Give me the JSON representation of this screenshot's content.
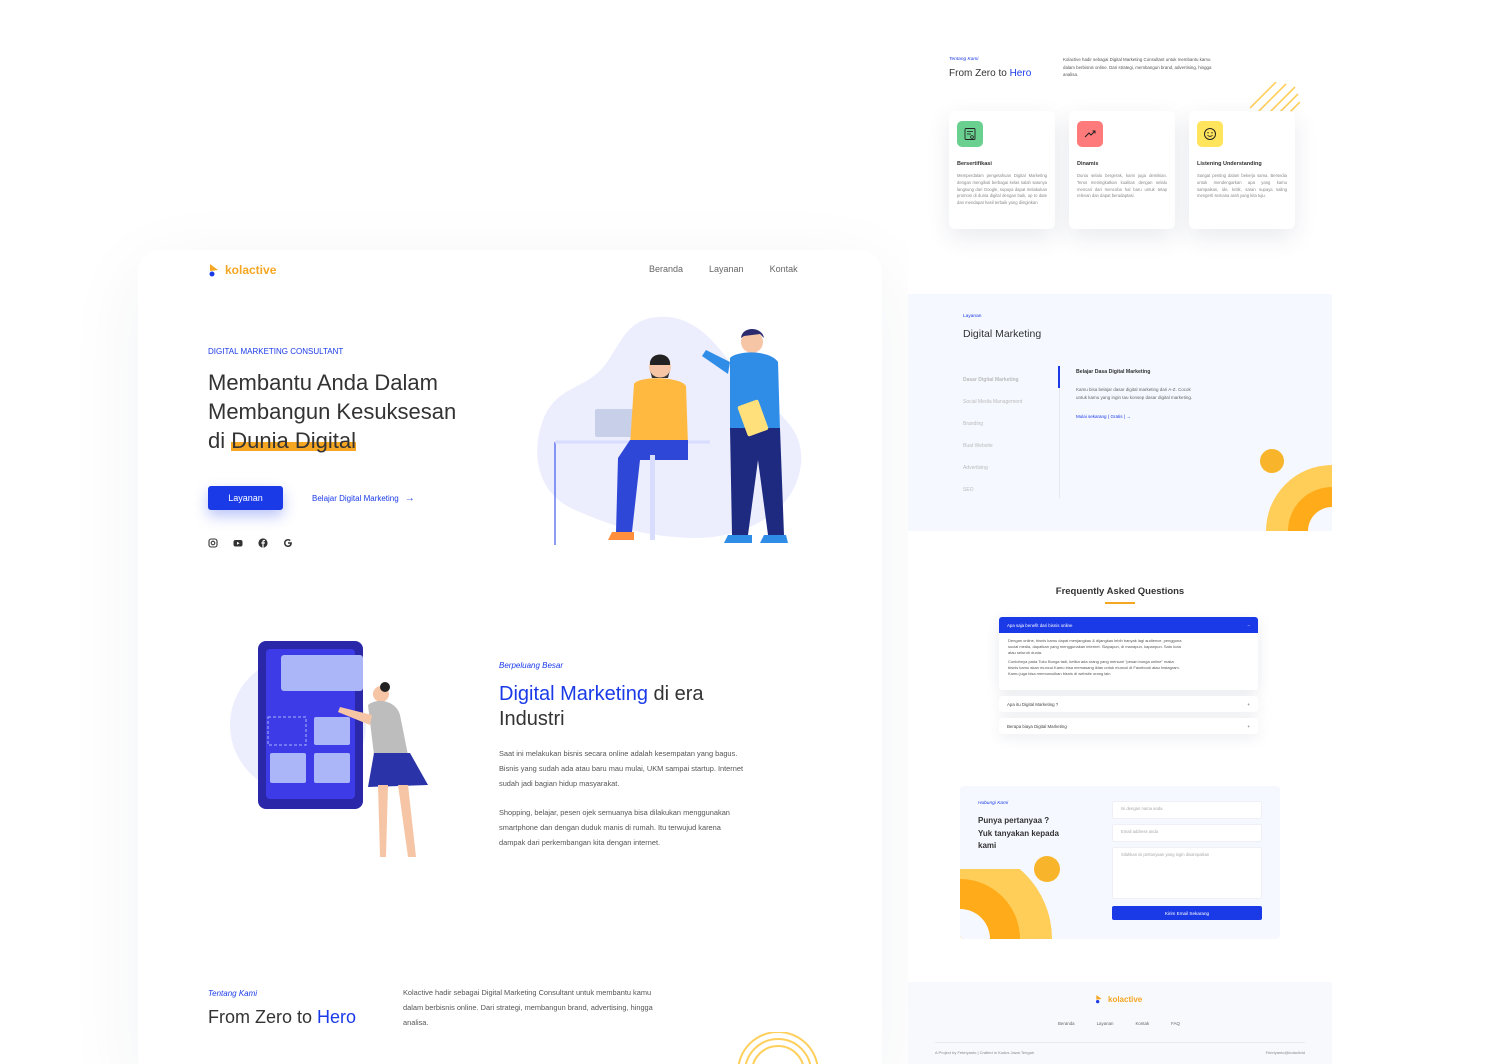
{
  "brand": {
    "name": "kolactive"
  },
  "colors": {
    "primary": "#1a3ae8",
    "accent": "#f5a623",
    "bg_light": "#f5f8ff"
  },
  "nav": [
    {
      "label": "Beranda"
    },
    {
      "label": "Layanan"
    },
    {
      "label": "Kontak"
    }
  ],
  "hero": {
    "eyebrow": "DIGITAL MARKETING CONSULTANT",
    "line1": "Membantu Anda Dalam",
    "line2": "Membangun Kesuksesan",
    "line3_prefix": "di ",
    "line3_highlight": "Dunia Digital",
    "cta_primary": "Layanan",
    "cta_secondary": "Belajar Digital Marketing",
    "socials": [
      "instagram-icon",
      "youtube-icon",
      "facebook-icon",
      "google-icon"
    ]
  },
  "opportunity": {
    "eyebrow": "Berpeluang Besar",
    "title_highlight": "Digital Marketing",
    "title_rest1": " di era",
    "title_rest2": "Industri",
    "para1": [
      "Saat ini melakukan bisnis secara online adalah kesempatan yang bagus.",
      "Bisnis yang sudah ada atau baru mau mulai, UKM sampai startup.  Internet",
      "sudah jadi bagian hidup masyarakat."
    ],
    "para2": [
      "Shopping, belajar, pesen ojek semuanya bisa dilakukan menggunakan",
      "smartphone dan dengan duduk manis di rumah. Itu terwujud karena",
      "dampak dari perkembangan kita dengan internet."
    ]
  },
  "about": {
    "eyebrow": "Tentang Kami",
    "title_prefix": "From Zero to ",
    "title_highlight": "Hero",
    "text": [
      "Kolactive hadir sebagai Digital Marketing Consultant untuk membantu kamu",
      "dalam berbisnis online. Dari strategi, membangun brand, advertising, hingga",
      "analisa."
    ]
  },
  "features": [
    {
      "icon": "certificate-icon",
      "title": "Bersertifikasi",
      "text": "Memperdalam pengetahuan Digital Marketing dengan mengikuti berbagai kelas salah satunya langsung dari Google, supaya dapat melakukan promosi di dunia digital dengan baik, up to date dan mendapat hasil terbaik yang diinginkan",
      "color": "#6ad08f"
    },
    {
      "icon": "trend-up-icon",
      "title": "Dinamis",
      "text": "Dunia selalu bergerak, kami juga demikian. Terus meningkatkan kualitas dengan selalu mencari dari mencoba hal baru untuk tetap relevan dan dapat beradaptasi.",
      "color": "#ff7a7a"
    },
    {
      "icon": "smile-icon",
      "title": "Listening Understanding",
      "text": "Sangat penting dalam bekerja sama. Bersedia untuk mendengarkan apa yang kamu sampaikan, ide, kritik, saran supaya saling mengerti semana arah yang kita tuju.",
      "color": "#ffe45c"
    }
  ],
  "services": {
    "eyebrow": "Layanan",
    "title": "Digital Marketing",
    "items": [
      {
        "label": "Dasar Digital Marketing"
      },
      {
        "label": "Social Media Management"
      },
      {
        "label": "Branding"
      },
      {
        "label": "Buat Website"
      },
      {
        "label": "Advertising"
      },
      {
        "label": "SEO"
      }
    ],
    "detail_title": "Belajar Dasa Digital Marketing",
    "detail_text": [
      "Kamu bisa belajar dasar digital marketing dari A-Z. Cocok",
      "untuk kamu yang ingin tau konsep dasar digital marketing."
    ],
    "detail_link": "Mulai sekarang ( Gratis )"
  },
  "faq": {
    "title": "Frequently Asked Questions",
    "items": [
      {
        "q": "Apa saja benefit dari bisnis online",
        "open": true,
        "a1": [
          "Dengan online, bisnis kamu dapat menjangkau & dijangkau lebih banyak lagi audience, pengguna",
          "social media, dapatkan yang menggunakan internet. Siapapun, di manapun, kapanpun. Satu kota",
          "atau seluruh dunia."
        ],
        "a2": [
          "Contohnya pada Toko Bunga tadi, ketika ada orang yang mencari \"pesan bunga online\" maka",
          "bisnis kamu akan muncul.Kamu bisa memasang iklan untuk muncul di Facebook atau Instagram.",
          "Kamu juga bisa memunculkan bisnis di website orang lain"
        ]
      },
      {
        "q": "Apa itu Digital Marketing ?",
        "open": false
      },
      {
        "q": "Berapa biaya Digital Marketing",
        "open": false
      }
    ]
  },
  "contact": {
    "eyebrow": "Hubungi Kami",
    "title": [
      "Punya pertanyaa ?",
      "Yuk tanyakan kepada",
      "kami"
    ],
    "name_placeholder": "Isi dengan nama anda",
    "email_placeholder": "Email address anda",
    "message_placeholder": "Silahkan isi pertanyaan yang ingin disampaikan",
    "submit": "Kirim Email Sekarang"
  },
  "footer": {
    "links": [
      {
        "label": "Beranda"
      },
      {
        "label": "Layanan"
      },
      {
        "label": "Kontak"
      },
      {
        "label": "FAQ"
      }
    ],
    "credit": "A Project by Febriyanto | Crafted in Kudus Jawa Tengah",
    "email": "Febriyanto@kolactivid"
  }
}
